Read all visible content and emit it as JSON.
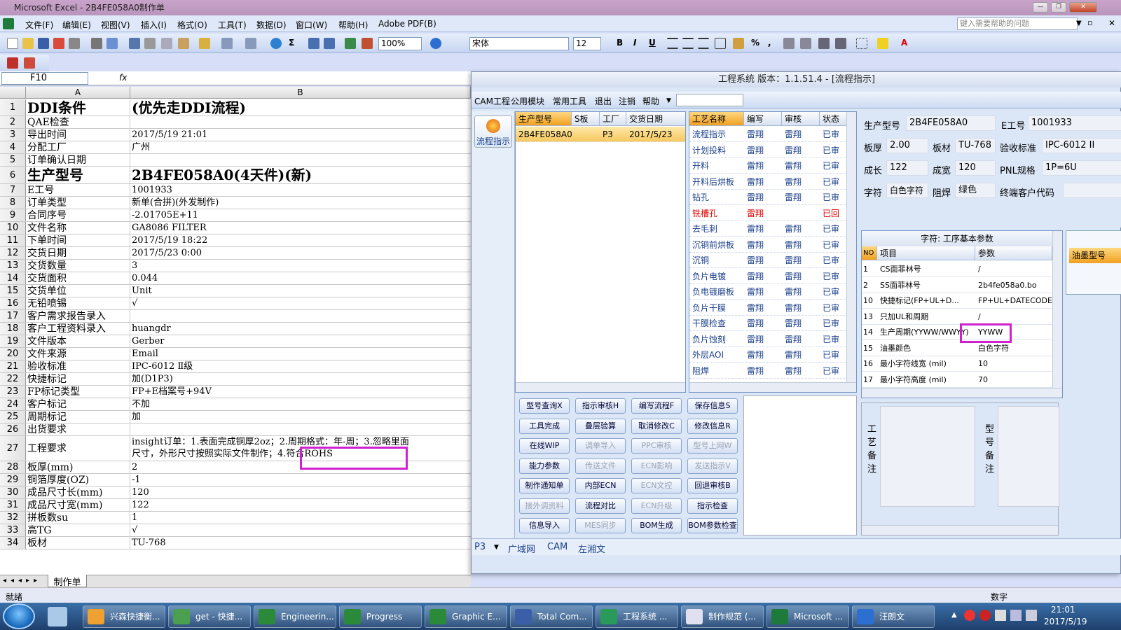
{
  "window": {
    "title": "Microsoft Excel - 2B4FE058A0制作单"
  },
  "menubar": {
    "items": [
      "文件(F)",
      "编辑(E)",
      "视图(V)",
      "插入(I)",
      "格式(O)",
      "工具(T)",
      "数据(D)",
      "窗口(W)",
      "帮助(H)",
      "Adobe PDF(B)"
    ],
    "help_placeholder": "键入需要帮助的问题"
  },
  "toolbar": {
    "zoom": "100%",
    "font": "宋体",
    "font_size": "12",
    "bold": "B",
    "italic": "I",
    "underline": "U",
    "percent": "%",
    "comma": ","
  },
  "formula_bar": {
    "cell_ref": "F10",
    "fx": "fx"
  },
  "sheet": {
    "col_a": "A",
    "col_b": "B",
    "rows": [
      {
        "n": "1",
        "a": "DDI条件",
        "b": "(优先走DDI流程)"
      },
      {
        "n": "2",
        "a": "QAE检查",
        "b": ""
      },
      {
        "n": "3",
        "a": "导出时间",
        "b": "2017/5/19 21:01"
      },
      {
        "n": "4",
        "a": "分配工厂",
        "b": "广州"
      },
      {
        "n": "5",
        "a": "订单确认日期",
        "b": ""
      },
      {
        "n": "6",
        "a": "生产型号",
        "b": "2B4FE058A0(4天件)(新)"
      },
      {
        "n": "7",
        "a": "E工号",
        "b": "1001933"
      },
      {
        "n": "8",
        "a": "订单类型",
        "b": "新单(合拼)(外发制作)"
      },
      {
        "n": "9",
        "a": "合同序号",
        "b": "-2.01705E+11"
      },
      {
        "n": "10",
        "a": "文件名称",
        "b": "GA8086 FILTER"
      },
      {
        "n": "11",
        "a": "下单时间",
        "b": "2017/5/19 18:22"
      },
      {
        "n": "12",
        "a": "交货日期",
        "b": "2017/5/23 0:00"
      },
      {
        "n": "13",
        "a": "交货数量",
        "b": "3"
      },
      {
        "n": "14",
        "a": "交货面积",
        "b": "0.044"
      },
      {
        "n": "15",
        "a": "交货单位",
        "b": "Unit"
      },
      {
        "n": "16",
        "a": "无铅喷锡",
        "b": "√"
      },
      {
        "n": "17",
        "a": "客户需求报告录入",
        "b": ""
      },
      {
        "n": "18",
        "a": "客户工程资料录入",
        "b": "huangdr"
      },
      {
        "n": "19",
        "a": "文件版本",
        "b": "Gerber"
      },
      {
        "n": "20",
        "a": "文件来源",
        "b": "Email"
      },
      {
        "n": "21",
        "a": "验收标准",
        "b": "IPC-6012 Ⅱ级"
      },
      {
        "n": "22",
        "a": "快捷标记",
        "b": "加(D1P3)"
      },
      {
        "n": "23",
        "a": "FP标记类型",
        "b": "FP+E档案号+94V"
      },
      {
        "n": "24",
        "a": "客户标记",
        "b": "不加"
      },
      {
        "n": "25",
        "a": "周期标记",
        "b": "加"
      },
      {
        "n": "26",
        "a": "出货要求",
        "b": ""
      },
      {
        "n": "27",
        "a": "工程要求",
        "b": "insight订单：1.表面完成铜厚2oz；2.周期格式：年-周；3.忽略里面",
        "b2": "尺寸，外形尺寸按照实际文件制作；4.符合ROHS"
      },
      {
        "n": "28",
        "a": "板厚(mm)",
        "b": "2"
      },
      {
        "n": "29",
        "a": "铜箔厚度(OZ)",
        "b": "-1"
      },
      {
        "n": "30",
        "a": "成品尺寸长(mm)",
        "b": "120"
      },
      {
        "n": "31",
        "a": "成品尺寸宽(mm)",
        "b": "122"
      },
      {
        "n": "32",
        "a": "拼板数su",
        "b": "1"
      },
      {
        "n": "33",
        "a": "高TG",
        "b": "√"
      },
      {
        "n": "34",
        "a": "板材",
        "b": "TU-768"
      }
    ],
    "tab": "制作单"
  },
  "status": {
    "left": "就绪",
    "right": "数字"
  },
  "cam": {
    "title": "工程系统  版本：1.1.51.4 - [流程指示]",
    "menu": [
      "CAM工程",
      "公用模块",
      "常用工具",
      "退出",
      "注销",
      "帮助"
    ],
    "side_button": "流程指示",
    "order_headers": [
      "生产型号",
      "S板",
      "工厂",
      "交货日期"
    ],
    "order_row": [
      "2B4FE058A0",
      "",
      "P3",
      "2017/5/23"
    ],
    "proc_headers": [
      "工艺名称",
      "编写",
      "审核",
      "状态"
    ],
    "processes": [
      {
        "name": "流程指示",
        "w": "雷翔",
        "r": "雷翔",
        "s": "已审"
      },
      {
        "name": "计划投料",
        "w": "雷翔",
        "r": "雷翔",
        "s": "已审"
      },
      {
        "name": "开料",
        "w": "雷翔",
        "r": "雷翔",
        "s": "已审"
      },
      {
        "name": "开料后烘板",
        "w": "雷翔",
        "r": "雷翔",
        "s": "已审"
      },
      {
        "name": "钻孔",
        "w": "雷翔",
        "r": "雷翔",
        "s": "已审"
      },
      {
        "name": "铣槽孔",
        "w": "雷翔",
        "r": "",
        "s": "已回"
      },
      {
        "name": "去毛刺",
        "w": "雷翔",
        "r": "雷翔",
        "s": "已审"
      },
      {
        "name": "沉铜前烘板",
        "w": "雷翔",
        "r": "雷翔",
        "s": "已审"
      },
      {
        "name": "沉铜",
        "w": "雷翔",
        "r": "雷翔",
        "s": "已审"
      },
      {
        "name": "负片电镀",
        "w": "雷翔",
        "r": "雷翔",
        "s": "已审"
      },
      {
        "name": "负电镀磨板",
        "w": "雷翔",
        "r": "雷翔",
        "s": "已审"
      },
      {
        "name": "负片干膜",
        "w": "雷翔",
        "r": "雷翔",
        "s": "已审"
      },
      {
        "name": "干膜检查",
        "w": "雷翔",
        "r": "雷翔",
        "s": "已审"
      },
      {
        "name": "负片蚀刻",
        "w": "雷翔",
        "r": "雷翔",
        "s": "已审"
      },
      {
        "name": "外层AOI",
        "w": "雷翔",
        "r": "雷翔",
        "s": "已审"
      },
      {
        "name": "阻焊",
        "w": "雷翔",
        "r": "雷翔",
        "s": "已审"
      }
    ],
    "buttons": [
      [
        "型号查询X",
        "指示审核H",
        "编写流程F",
        "保存信息S"
      ],
      [
        "工具完成",
        "叠层验算",
        "取消修改C",
        "修改信息R"
      ],
      [
        "在线WIP",
        "调单导入",
        "PPC审核",
        "型号上网W"
      ],
      [
        "能力参数",
        "传送文件",
        "ECN影响",
        "发送指示V"
      ],
      [
        "制作通知单",
        "内部ECN",
        "ECN文控",
        "回退审核B"
      ],
      [
        "接外调资料",
        "流程对比",
        "ECN升级",
        "指示检查"
      ],
      [
        "信息导入",
        "MES同步",
        "BOM生成",
        "BOM参数检查"
      ]
    ],
    "disabled_buttons": [
      "调单导入",
      "PPC审核",
      "型号上网W",
      "传送文件",
      "ECN影响",
      "发送指示V",
      "ECN文控",
      "接外调资料",
      "ECN升级",
      "MES同步"
    ],
    "info": {
      "model_label": "生产型号",
      "model": "2B4FE058A0",
      "eno_label": "E工号",
      "eno": "1001933",
      "thick_label": "板厚",
      "thick": "2.00",
      "mat_label": "板材",
      "mat": "TU-768",
      "std_label": "验收标准",
      "std": "IPC-6012 II",
      "len_label": "成长",
      "len": "122",
      "wid_label": "成宽",
      "wid": "120",
      "pnl_label": "PNL规格",
      "pnl": "1P=6U",
      "char_label": "字符",
      "char": "白色字符",
      "mask_label": "阻焊",
      "mask": "绿色",
      "cust_label": "终端客户代码",
      "cust": ""
    },
    "params": {
      "title": "字符: 工序基本参数",
      "h_no": "NO",
      "h_item": "项目",
      "h_val": "参数",
      "rows": [
        {
          "no": "1",
          "item": "CS面菲林号",
          "val": "/"
        },
        {
          "no": "2",
          "item": "SS面菲林号",
          "val": "2b4fe058a0.bo"
        },
        {
          "no": "10",
          "item": "快捷标记(FP+UL+D...",
          "val": "FP+UL+DATECODE"
        },
        {
          "no": "13",
          "item": "只加UL和周期",
          "val": "/"
        },
        {
          "no": "14",
          "item": "生产周期(YYWW/WWYY)",
          "val": "YYWW"
        },
        {
          "no": "15",
          "item": "油墨颜色",
          "val": "白色字符"
        },
        {
          "no": "16",
          "item": "最小字符线宽 (mil)",
          "val": "10"
        },
        {
          "no": "17",
          "item": "最小字符高度 (mil)",
          "val": "70"
        }
      ]
    },
    "side_panel_label": "油墨型号",
    "note_labels": {
      "proc": "工艺备注",
      "model": "型号备注"
    },
    "bottom_tabs": [
      "P3",
      "广域网",
      "CAM",
      "左湘文"
    ]
  },
  "taskbar": {
    "items": [
      "兴森快捷衡...",
      "get - 快捷...",
      "Engineerin...",
      "Progress",
      "Graphic E...",
      "Total Com...",
      "工程系统 ...",
      "制作规范 (...",
      "Microsoft ...",
      "汪朗文"
    ],
    "time": "21:01",
    "date": "2017/5/19"
  }
}
